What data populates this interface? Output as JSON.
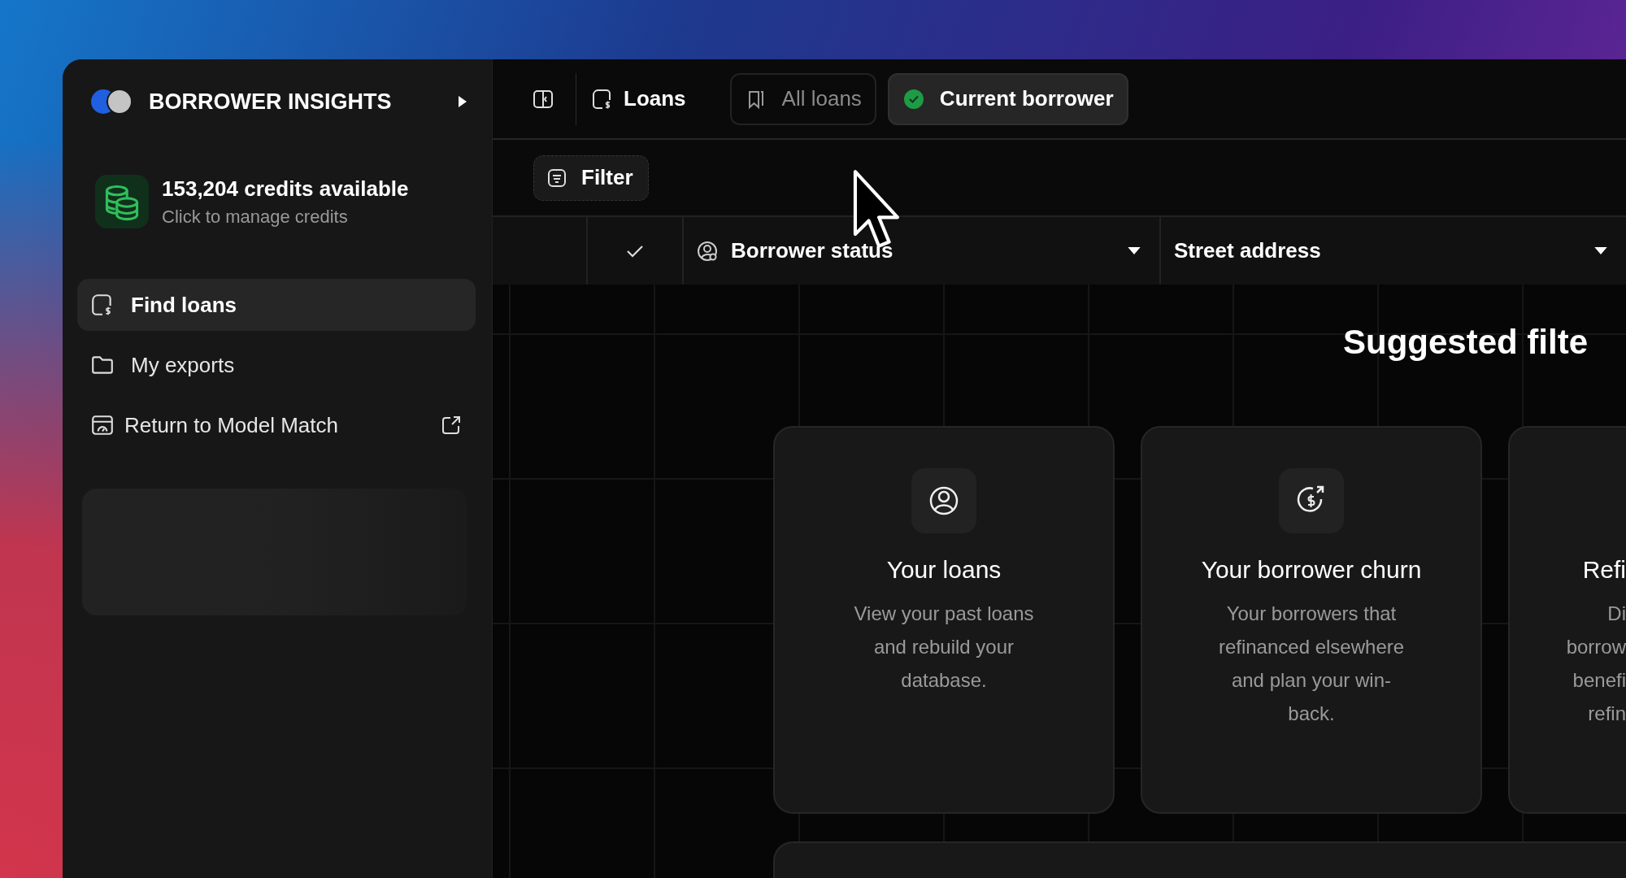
{
  "sidebar": {
    "brand": "BORROWER INSIGHTS",
    "credits": {
      "title": "153,204 credits available",
      "subtitle": "Click to manage credits"
    },
    "nav": [
      {
        "label": "Find loans",
        "kind": "loans",
        "selected": true,
        "external": false
      },
      {
        "label": "My exports",
        "kind": "folder",
        "selected": false,
        "external": false
      },
      {
        "label": "Return to Model Match",
        "kind": "dashboard",
        "selected": false,
        "external": true
      }
    ]
  },
  "toolbar": {
    "section": "Loans",
    "tabs": [
      {
        "label": "All loans",
        "kind": "bookmark",
        "selected": false
      },
      {
        "label": "Current borrower",
        "kind": "check",
        "selected": true
      }
    ]
  },
  "filter_button": "Filter",
  "table": {
    "columns": [
      {
        "label": "Borrower status",
        "kind": "person"
      },
      {
        "label": "Street address",
        "kind": "plain"
      }
    ]
  },
  "suggested": {
    "title": "Suggested filte",
    "cards": [
      {
        "kind": "person",
        "title": "Your loans",
        "lines": [
          "View your past loans",
          "and rebuild your",
          "database."
        ]
      },
      {
        "kind": "churn",
        "title": "Your borrower churn",
        "lines": [
          "Your borrowers that",
          "refinanced elsewhere",
          "and plan your win-",
          "back."
        ]
      },
      {
        "kind": "none",
        "title": "Refi",
        "lines": [
          "Di",
          "borrow",
          "benefi",
          "refin"
        ]
      }
    ]
  }
}
